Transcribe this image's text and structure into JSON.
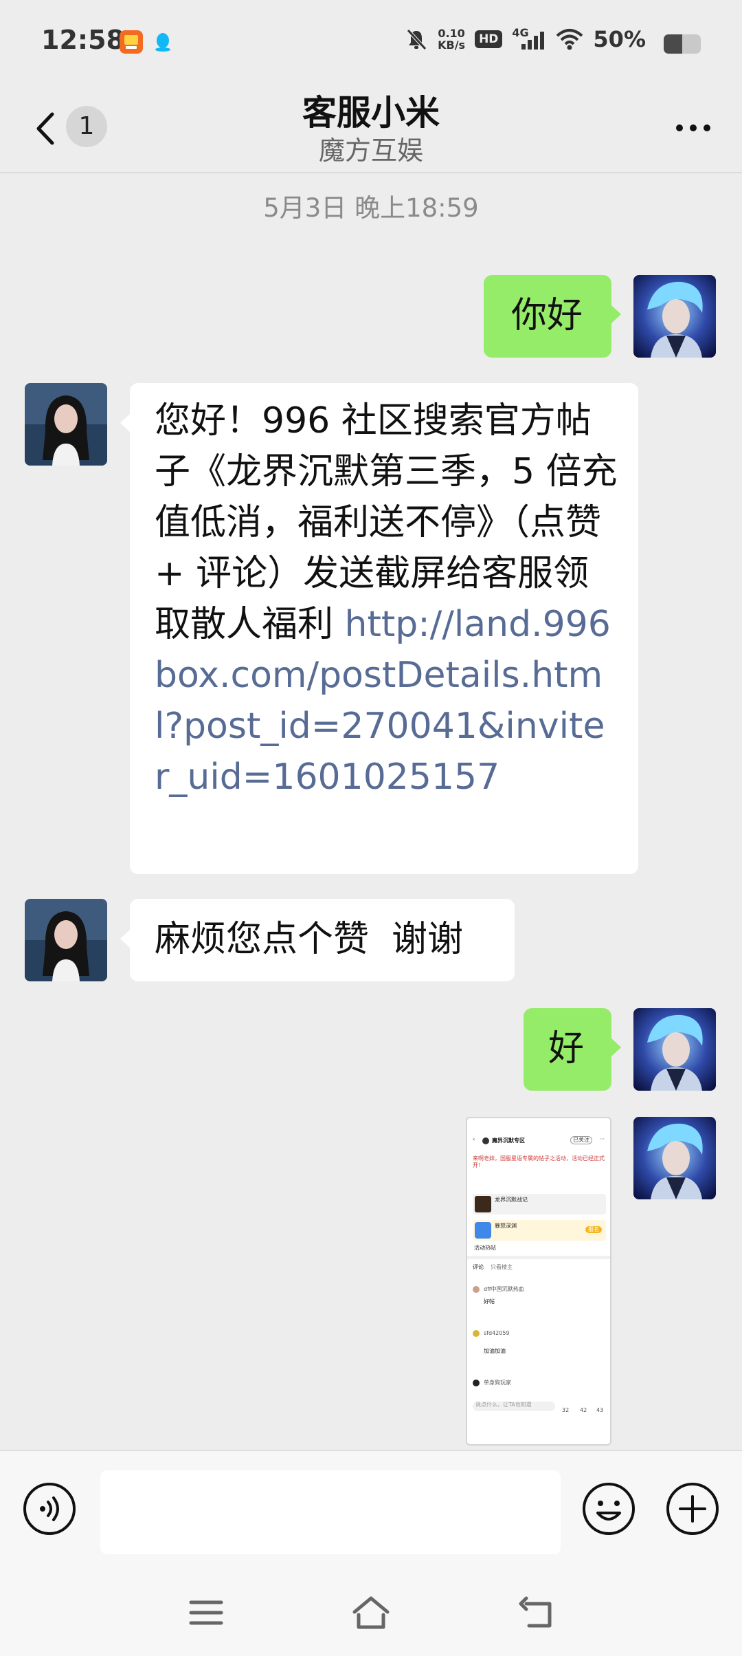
{
  "status_bar": {
    "time": "12:58",
    "net_speed_value": "0.10",
    "net_speed_unit": "KB/s",
    "hd": "HD",
    "network": "4G",
    "battery": "50%",
    "battery_level": 0.5,
    "icons": [
      "app-notification-icon",
      "qq-icon",
      "mute-icon",
      "hd-icon",
      "signal-icon",
      "wifi-icon",
      "battery-icon"
    ]
  },
  "header": {
    "back_badge": "1",
    "title": "客服小米",
    "subtitle": "魔方互娱"
  },
  "messages": {
    "timestamp": "5月3日 晚上18:59",
    "m1_text": "你好",
    "m2_text": "您好！996 社区搜索官方帖子《龙界沉默第三季，5 倍充值低消，福利送不停》（点赞 + 评论）发送截屏给客服领取散人福利 ",
    "m2_link": "http://land.996box.com/postDetails.html?post_id=270041&inviter_uid=1601025157",
    "m3_text": "麻烦您点个赞  谢谢",
    "m4_text": "好"
  },
  "screenshot": {
    "title": "魔界沉默专区",
    "follow": "已关注",
    "notice": "来啊老妹，国服星语专属的帖子之活动，活动已经正式开！",
    "game_name": "龙界沉默战记",
    "section_name": "暴怒深渊",
    "join": "报名",
    "hot": "活动热帖",
    "comments_tab": "评论",
    "all_tab": "只看楼主",
    "c1_name": "dff中国沉默热血",
    "c1_text": "好帖",
    "c2_name": "sfd42059",
    "c2_text": "加油加油",
    "c3_name": "单身狗玩家",
    "reply_placeholder": "说点什么，让TA也知道",
    "count_likes": "32",
    "count_comments": "42",
    "count_shares": "43"
  },
  "input_bar": {
    "placeholder": ""
  },
  "colors": {
    "bubble_me": "#95ec69",
    "bubble_them": "#ffffff",
    "link": "#576b95",
    "background": "#ededed"
  }
}
